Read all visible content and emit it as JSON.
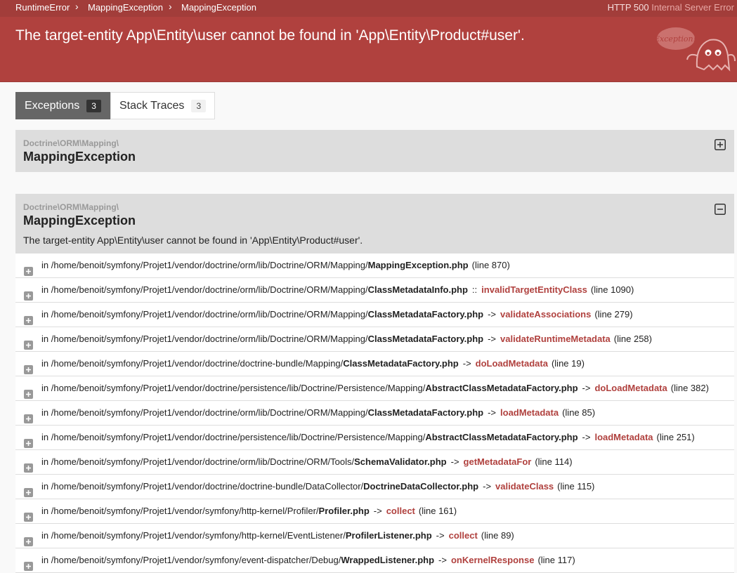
{
  "header": {
    "breadcrumbs": [
      "RuntimeError",
      "MappingException",
      "MappingException"
    ],
    "status_code": "HTTP 500",
    "status_text": "Internal Server Error",
    "title": "The target-entity App\\Entity\\user cannot be found in 'App\\Entity\\Product#user'.",
    "mascot_text": "Exception!"
  },
  "tabs": [
    {
      "label": "Exceptions",
      "count": "3",
      "active": true
    },
    {
      "label": "Stack Traces",
      "count": "3",
      "active": false
    }
  ],
  "exceptions": [
    {
      "namespace": "Doctrine\\ORM\\Mapping\\",
      "class": "MappingException",
      "collapsed": true
    },
    {
      "namespace": "Doctrine\\ORM\\Mapping\\",
      "class": "MappingException",
      "message": "The target-entity App\\Entity\\user cannot be found in 'App\\Entity\\Product#user'.",
      "collapsed": false
    }
  ],
  "trace_prefix": "in",
  "traces": [
    {
      "path": "/home/benoit/symfony/Projet1/vendor/doctrine/orm/lib/Doctrine/ORM/Mapping/",
      "file": "MappingException.php",
      "op": "",
      "fn": "",
      "line": "(line 870)"
    },
    {
      "path": "/home/benoit/symfony/Projet1/vendor/doctrine/orm/lib/Doctrine/ORM/Mapping/",
      "file": "ClassMetadataInfo.php",
      "op": "::",
      "fn": "invalidTargetEntityClass",
      "line": "(line 1090)"
    },
    {
      "path": "/home/benoit/symfony/Projet1/vendor/doctrine/orm/lib/Doctrine/ORM/Mapping/",
      "file": "ClassMetadataFactory.php",
      "op": "->",
      "fn": "validateAssociations",
      "line": "(line 279)"
    },
    {
      "path": "/home/benoit/symfony/Projet1/vendor/doctrine/orm/lib/Doctrine/ORM/Mapping/",
      "file": "ClassMetadataFactory.php",
      "op": "->",
      "fn": "validateRuntimeMetadata",
      "line": "(line 258)"
    },
    {
      "path": "/home/benoit/symfony/Projet1/vendor/doctrine/doctrine-bundle/Mapping/",
      "file": "ClassMetadataFactory.php",
      "op": "->",
      "fn": "doLoadMetadata",
      "line": "(line 19)"
    },
    {
      "path": "/home/benoit/symfony/Projet1/vendor/doctrine/persistence/lib/Doctrine/Persistence/Mapping/",
      "file": "AbstractClassMetadataFactory.php",
      "op": "->",
      "fn": "doLoadMetadata",
      "line": "(line 382)"
    },
    {
      "path": "/home/benoit/symfony/Projet1/vendor/doctrine/orm/lib/Doctrine/ORM/Mapping/",
      "file": "ClassMetadataFactory.php",
      "op": "->",
      "fn": "loadMetadata",
      "line": "(line 85)"
    },
    {
      "path": "/home/benoit/symfony/Projet1/vendor/doctrine/persistence/lib/Doctrine/Persistence/Mapping/",
      "file": "AbstractClassMetadataFactory.php",
      "op": "->",
      "fn": "loadMetadata",
      "line": "(line 251)"
    },
    {
      "path": "/home/benoit/symfony/Projet1/vendor/doctrine/orm/lib/Doctrine/ORM/Tools/",
      "file": "SchemaValidator.php",
      "op": "->",
      "fn": "getMetadataFor",
      "line": "(line 114)"
    },
    {
      "path": "/home/benoit/symfony/Projet1/vendor/doctrine/doctrine-bundle/DataCollector/",
      "file": "DoctrineDataCollector.php",
      "op": "->",
      "fn": "validateClass",
      "line": "(line 115)"
    },
    {
      "path": "/home/benoit/symfony/Projet1/vendor/symfony/http-kernel/Profiler/",
      "file": "Profiler.php",
      "op": "->",
      "fn": "collect",
      "line": "(line 161)"
    },
    {
      "path": "/home/benoit/symfony/Projet1/vendor/symfony/http-kernel/EventListener/",
      "file": "ProfilerListener.php",
      "op": "->",
      "fn": "collect",
      "line": "(line 89)"
    },
    {
      "path": "/home/benoit/symfony/Projet1/vendor/symfony/event-dispatcher/Debug/",
      "file": "WrappedListener.php",
      "op": "->",
      "fn": "onKernelResponse",
      "line": "(line 117)"
    }
  ]
}
